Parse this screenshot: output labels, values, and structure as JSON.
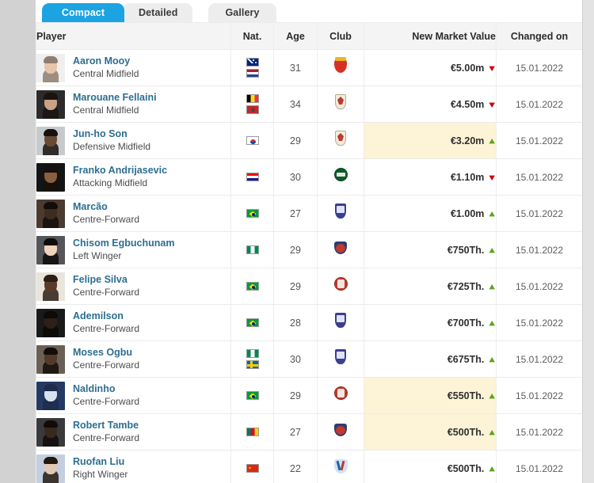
{
  "tabs": [
    {
      "label": "Compact",
      "active": true
    },
    {
      "label": "Detailed",
      "active": false
    },
    {
      "label": "Gallery",
      "active": false
    }
  ],
  "columns": {
    "player": "Player",
    "nat": "Nat.",
    "age": "Age",
    "club": "Club",
    "market_value": "New Market Value",
    "changed_on": "Changed on"
  },
  "colors": {
    "active_tab": "#1ba3e2",
    "inactive_tab": "#ededed",
    "player_link": "#2c6e92",
    "highlight_cell": "#fdf3d7",
    "arrow_up": "#5aa51b",
    "arrow_down": "#cc0000",
    "header_bg": "#f4f4f4",
    "page_bg": "#d2d2d2"
  },
  "icons": {
    "arrow_up": "arrow-up-icon",
    "arrow_down": "arrow-down-icon"
  },
  "rows": [
    {
      "name": "Aaron Mooy",
      "position": "Central Midfield",
      "nationalities": [
        "Australia",
        "Netherlands"
      ],
      "age": "31",
      "club": "Shanghai Port FC",
      "market_value": "€5.00m",
      "trend": "down",
      "highlight": false,
      "changed_on": "15.01.2022"
    },
    {
      "name": "Marouane Fellaini",
      "position": "Central Midfield",
      "nationalities": [
        "Belgium",
        "Morocco"
      ],
      "age": "34",
      "club": "Shandong Taishan",
      "market_value": "€4.50m",
      "trend": "down",
      "highlight": false,
      "changed_on": "15.01.2022"
    },
    {
      "name": "Jun-ho Son",
      "position": "Defensive Midfield",
      "nationalities": [
        "Korea, South"
      ],
      "age": "29",
      "club": "Shandong Taishan",
      "market_value": "€3.20m",
      "trend": "up",
      "highlight": true,
      "changed_on": "15.01.2022"
    },
    {
      "name": "Franko Andrijasevic",
      "position": "Attacking Midfield",
      "nationalities": [
        "Croatia"
      ],
      "age": "30",
      "club": "Beijing Guoan",
      "market_value": "€1.10m",
      "trend": "down",
      "highlight": false,
      "changed_on": "15.01.2022"
    },
    {
      "name": "Marcão",
      "position": "Centre-Forward",
      "nationalities": [
        "Brazil"
      ],
      "age": "27",
      "club": "Hebei FC",
      "market_value": "€1.00m",
      "trend": "up",
      "highlight": false,
      "changed_on": "15.01.2022"
    },
    {
      "name": "Chisom Egbuchunam",
      "position": "Left Winger",
      "nationalities": [
        "Nigeria"
      ],
      "age": "29",
      "club": "Cangzhou Mighty Lions",
      "market_value": "€750Th.",
      "trend": "up",
      "highlight": false,
      "changed_on": "15.01.2022"
    },
    {
      "name": "Felipe Silva",
      "position": "Centre-Forward",
      "nationalities": [
        "Brazil"
      ],
      "age": "29",
      "club": "Wuhan FC",
      "market_value": "€725Th.",
      "trend": "up",
      "highlight": false,
      "changed_on": "15.01.2022"
    },
    {
      "name": "Ademilson",
      "position": "Centre-Forward",
      "nationalities": [
        "Brazil"
      ],
      "age": "28",
      "club": "Hebei FC",
      "market_value": "€700Th.",
      "trend": "up",
      "highlight": false,
      "changed_on": "15.01.2022"
    },
    {
      "name": "Moses Ogbu",
      "position": "Centre-Forward",
      "nationalities": [
        "Nigeria",
        "Sweden"
      ],
      "age": "30",
      "club": "Hebei FC",
      "market_value": "€675Th.",
      "trend": "up",
      "highlight": false,
      "changed_on": "15.01.2022"
    },
    {
      "name": "Naldinho",
      "position": "Centre-Forward",
      "nationalities": [
        "Brazil"
      ],
      "age": "29",
      "club": "Wuhan FC",
      "market_value": "€550Th.",
      "trend": "up",
      "highlight": true,
      "changed_on": "15.01.2022"
    },
    {
      "name": "Robert Tambe",
      "position": "Centre-Forward",
      "nationalities": [
        "Cameroon"
      ],
      "age": "27",
      "club": "Cangzhou Mighty Lions",
      "market_value": "€500Th.",
      "trend": "up",
      "highlight": true,
      "changed_on": "15.01.2022"
    },
    {
      "name": "Ruofan Liu",
      "position": "Right Winger",
      "nationalities": [
        "China"
      ],
      "age": "22",
      "club": "Shanghai Shenhua",
      "market_value": "€500Th.",
      "trend": "up",
      "highlight": false,
      "changed_on": "15.01.2022"
    }
  ]
}
